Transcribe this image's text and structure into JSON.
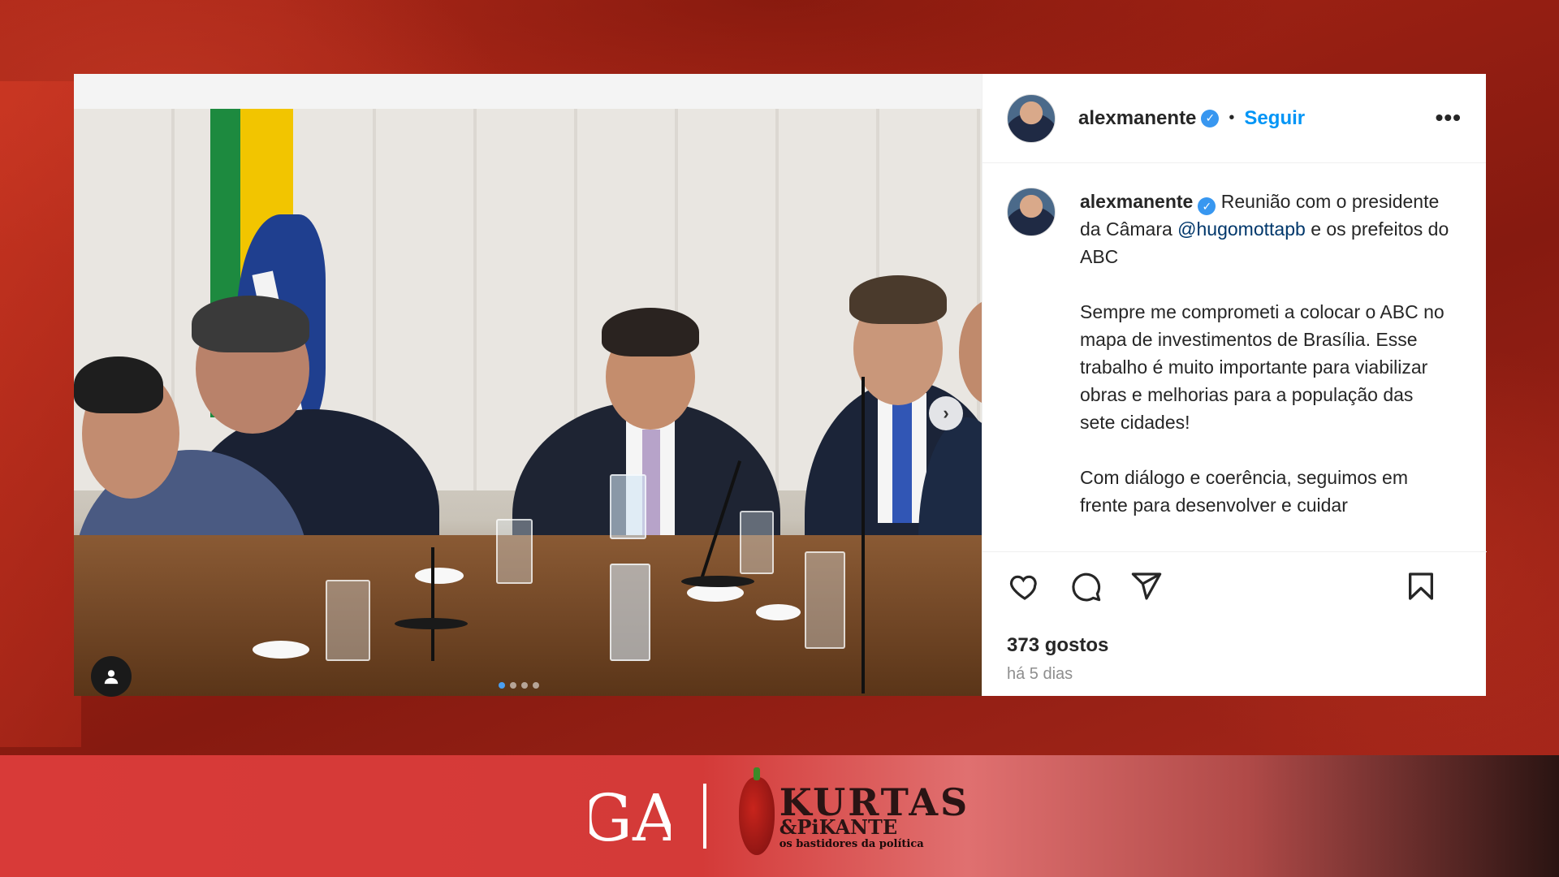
{
  "post": {
    "username": "alexmanente",
    "follow_label": "Seguir",
    "separator": "•",
    "more_label": "•••",
    "caption": {
      "username": "alexmanente",
      "line1": "Reunião com o presidente da Câmara",
      "mention": "@hugomottapb",
      "line1_tail": "e os prefeitos do ABC",
      "paragraph2": "Sempre me comprometi a colocar o ABC no mapa de investimentos de Brasília. Esse trabalho é muito importante para viabilizar obras e melhorias para a população das sete cidades!",
      "paragraph3": "Com diálogo e coerência, seguimos em frente para desenvolver e cuidar"
    },
    "likes": "373 gostos",
    "time_ago": "há 5 dias",
    "carousel_dots": 4,
    "active_dot": 0
  },
  "icons": {
    "like": "heart-icon",
    "comment": "comment-icon",
    "share": "share-icon",
    "save": "bookmark-icon",
    "next": "chevron-right-icon",
    "tag": "user-tag-icon",
    "verified": "verified-badge-icon"
  },
  "colors": {
    "link_blue": "#0095f6",
    "verified_blue": "#3897f0",
    "background_red": "#9a2013",
    "brandbar_red": "#d83a38"
  },
  "brand": {
    "logo_left": "GA",
    "logo_right_line1": "KURTAS",
    "logo_right_line2": "&PiKANTE",
    "logo_right_tagline": "os bastidores da política"
  }
}
